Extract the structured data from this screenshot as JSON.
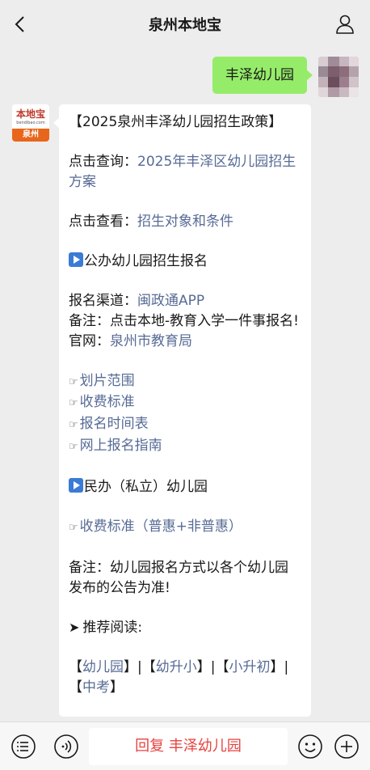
{
  "header": {
    "title": "泉州本地宝",
    "back_icon": "chevron-left-icon",
    "profile_icon": "person-icon"
  },
  "chat": {
    "user_message": "丰泽幼儿园",
    "bot_avatar": {
      "name": "本地宝",
      "url": "bendibao.com",
      "city": "泉州"
    },
    "bot_message": {
      "title": "【2025泉州丰泽幼儿园招生政策】",
      "query_label": "点击查询：",
      "query_link": "2025年丰泽区幼儿园招生方案",
      "view_label": "点击查看：",
      "view_link": "招生对象和条件",
      "public_section": "公办幼儿园招生报名",
      "channel_label": "报名渠道：",
      "channel_link": "闽政通APP",
      "note1": "备注：点击本地-教育入学一件事报名!",
      "site_label": "官网：",
      "site_link": "泉州市教育局",
      "public_links": [
        "划片范围",
        "收费标准",
        "报名时间表",
        "网上报名指南"
      ],
      "private_section": "民办（私立）幼儿园",
      "private_link": "收费标准（普惠+非普惠）",
      "note2": "备注：幼儿园报名方式以各个幼儿园发布的公告为准!",
      "recommend": "推荐阅读:",
      "tags": [
        "幼儿园",
        "幼升小",
        "小升初",
        "中考"
      ]
    }
  },
  "bottom_bar": {
    "reply_text": "回复 丰泽幼儿园",
    "icons": [
      "menu-list-icon",
      "voice-icon",
      "emoji-icon",
      "plus-icon"
    ]
  },
  "colors": {
    "background": "#ededed",
    "user_bubble": "#95ec69",
    "link": "#576b95",
    "reply_text": "#e64340",
    "brand_orange": "#e8661b"
  }
}
